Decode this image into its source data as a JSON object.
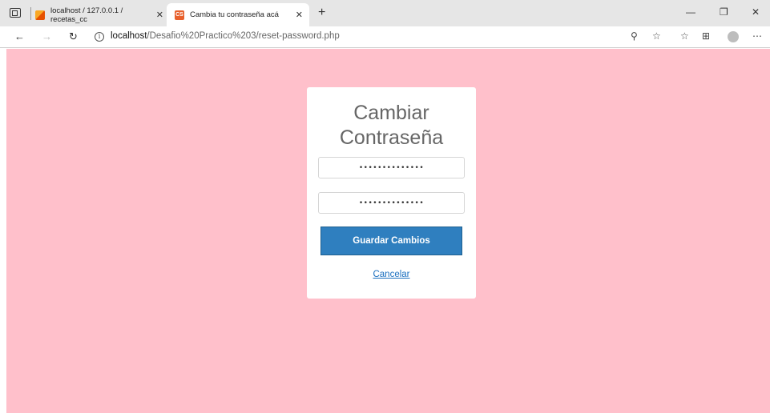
{
  "browser": {
    "tabs": [
      {
        "title": "localhost / 127.0.0.1 / recetas_cc",
        "active": false
      },
      {
        "title": "Cambia tu contraseña acá",
        "active": true,
        "favicon_text": "CS"
      }
    ],
    "url": {
      "host": "localhost",
      "path": "/Desafio%20Practico%203/reset-password.php"
    }
  },
  "page": {
    "background_color": "#ffc0cb",
    "title_line1": "Cambiar",
    "title_line2": "Contraseña",
    "password_value": "••••••••••••••",
    "confirm_value": "••••••••••••••",
    "save_label": "Guardar Cambios",
    "cancel_label": "Cancelar"
  }
}
